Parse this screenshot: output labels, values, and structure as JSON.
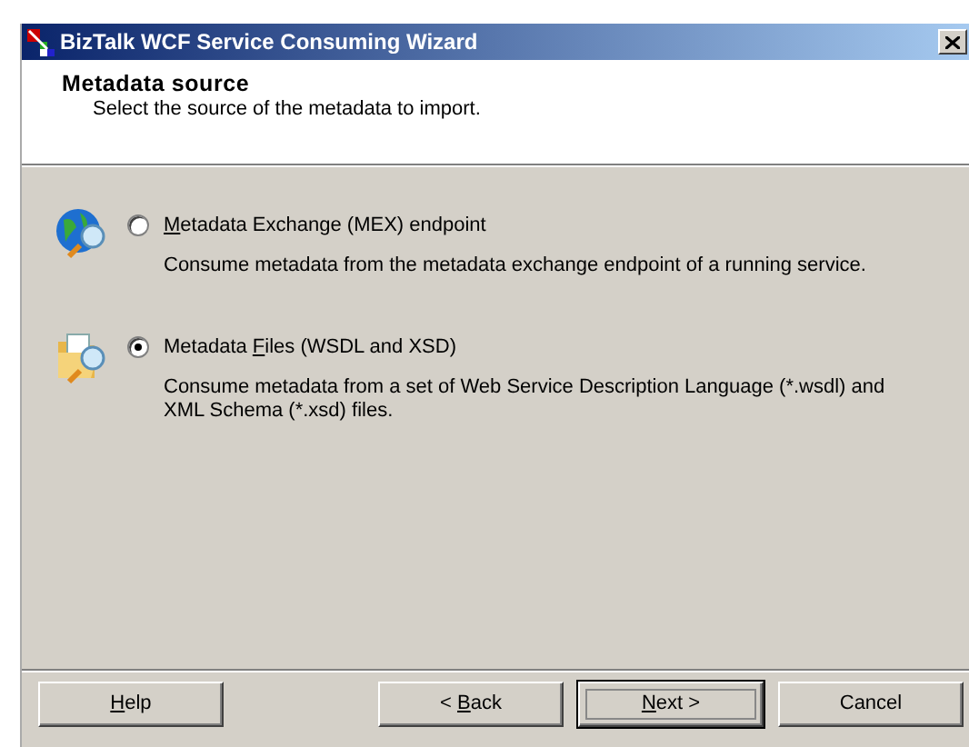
{
  "window": {
    "title": "BizTalk WCF Service Consuming Wizard"
  },
  "header": {
    "title": "Metadata source",
    "subtitle": "Select the source of the metadata to import."
  },
  "options": [
    {
      "kind": "globe",
      "selected": false,
      "label": {
        "key": "M",
        "after": "etadata Exchange (MEX) endpoint"
      },
      "description": "Consume metadata from the metadata exchange endpoint of a running service."
    },
    {
      "kind": "folder",
      "selected": true,
      "label": {
        "before": "Metadata ",
        "key": "F",
        "after": "iles (WSDL and XSD)"
      },
      "description": "Consume metadata from a set of Web Service Description Language (*.wsdl) and XML Schema (*.xsd) files."
    }
  ],
  "buttons": [
    {
      "kind": "help",
      "default": false,
      "label": {
        "key": "H",
        "after": "elp"
      }
    },
    {
      "kind": "back",
      "default": false,
      "label": {
        "before": "< ",
        "key": "B",
        "after": "ack"
      }
    },
    {
      "kind": "next",
      "default": true,
      "label": {
        "key": "N",
        "after": "ext >"
      }
    },
    {
      "kind": "cancel",
      "default": false,
      "label": {
        "before": "Cancel"
      }
    }
  ]
}
